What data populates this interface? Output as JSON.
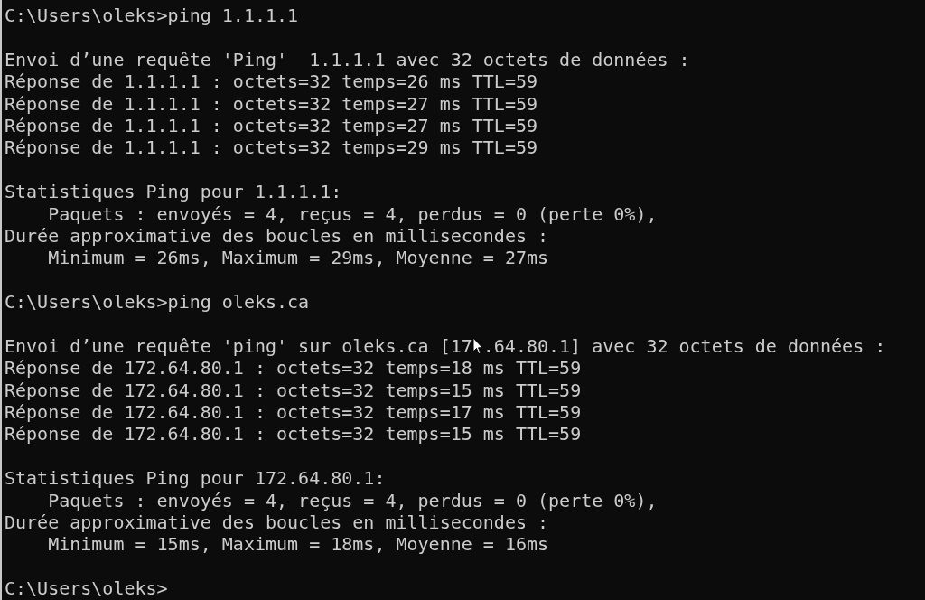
{
  "terminal": {
    "lines": [
      {
        "kind": "text",
        "text": "C:\\Users\\oleks>ping 1.1.1.1"
      },
      {
        "kind": "blank"
      },
      {
        "kind": "text",
        "text": "Envoi d’une requête 'Ping'  1.1.1.1 avec 32 octets de données :"
      },
      {
        "kind": "text",
        "text": "Réponse de 1.1.1.1 : octets=32 temps=26 ms TTL=59"
      },
      {
        "kind": "text",
        "text": "Réponse de 1.1.1.1 : octets=32 temps=27 ms TTL=59"
      },
      {
        "kind": "text",
        "text": "Réponse de 1.1.1.1 : octets=32 temps=27 ms TTL=59"
      },
      {
        "kind": "text",
        "text": "Réponse de 1.1.1.1 : octets=32 temps=29 ms TTL=59"
      },
      {
        "kind": "blank"
      },
      {
        "kind": "text",
        "text": "Statistiques Ping pour 1.1.1.1:"
      },
      {
        "kind": "text",
        "text": "    Paquets : envoyés = 4, reçus = 4, perdus = 0 (perte 0%),"
      },
      {
        "kind": "text",
        "text": "Durée approximative des boucles en millisecondes :"
      },
      {
        "kind": "text",
        "text": "    Minimum = 26ms, Maximum = 29ms, Moyenne = 27ms"
      },
      {
        "kind": "blank"
      },
      {
        "kind": "text",
        "text": "C:\\Users\\oleks>ping oleks.ca"
      },
      {
        "kind": "blank"
      },
      {
        "kind": "pointer",
        "parts": [
          "Envoi d’une requête 'ping' sur oleks.ca [17",
          ".64.80.1] avec 32 octets de données :"
        ]
      },
      {
        "kind": "text",
        "text": "Réponse de 172.64.80.1 : octets=32 temps=18 ms TTL=59"
      },
      {
        "kind": "text",
        "text": "Réponse de 172.64.80.1 : octets=32 temps=15 ms TTL=59"
      },
      {
        "kind": "text",
        "text": "Réponse de 172.64.80.1 : octets=32 temps=17 ms TTL=59"
      },
      {
        "kind": "text",
        "text": "Réponse de 172.64.80.1 : octets=32 temps=15 ms TTL=59"
      },
      {
        "kind": "blank"
      },
      {
        "kind": "text",
        "text": "Statistiques Ping pour 172.64.80.1:"
      },
      {
        "kind": "text",
        "text": "    Paquets : envoyés = 4, reçus = 4, perdus = 0 (perte 0%),"
      },
      {
        "kind": "text",
        "text": "Durée approximative des boucles en millisecondes :"
      },
      {
        "kind": "text",
        "text": "    Minimum = 15ms, Maximum = 18ms, Moyenne = 16ms"
      },
      {
        "kind": "blank"
      },
      {
        "kind": "text",
        "text": "C:\\Users\\oleks>"
      }
    ]
  }
}
